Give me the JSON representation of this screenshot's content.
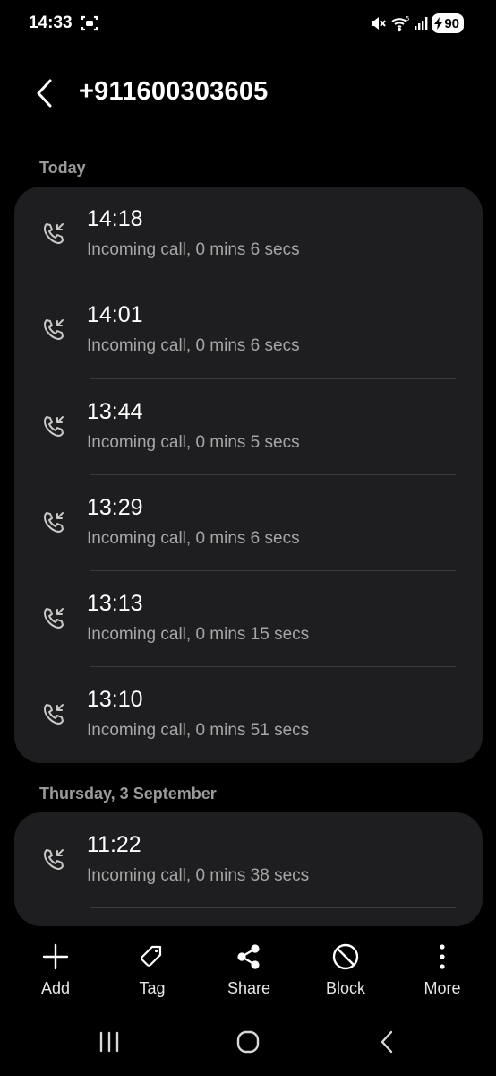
{
  "status_bar": {
    "time": "14:33",
    "battery_level": "90",
    "icons": [
      "screenshot-icon",
      "mute-icon",
      "wifi-icon",
      "signal-icon",
      "battery-charging-icon"
    ]
  },
  "header": {
    "title": "+911600303605",
    "back_icon": "chevron-left-icon"
  },
  "sections": [
    {
      "label": "Today",
      "calls": [
        {
          "time": "14:18",
          "description": "Incoming call, 0 mins 6 secs"
        },
        {
          "time": "14:01",
          "description": "Incoming call, 0 mins 6 secs"
        },
        {
          "time": "13:44",
          "description": "Incoming call, 0 mins 5 secs"
        },
        {
          "time": "13:29",
          "description": "Incoming call, 0 mins 6 secs"
        },
        {
          "time": "13:13",
          "description": "Incoming call, 0 mins 15 secs"
        },
        {
          "time": "13:10",
          "description": "Incoming call, 0 mins 51 secs"
        }
      ]
    },
    {
      "label": "Thursday, 3 September",
      "calls": [
        {
          "time": "11:22",
          "description": "Incoming call, 0 mins 38 secs"
        }
      ]
    }
  ],
  "actions": [
    {
      "label": "Add",
      "icon": "plus-icon"
    },
    {
      "label": "Tag",
      "icon": "tag-icon"
    },
    {
      "label": "Share",
      "icon": "share-icon"
    },
    {
      "label": "Block",
      "icon": "block-icon"
    },
    {
      "label": "More",
      "icon": "more-vertical-icon"
    }
  ],
  "navbar": {
    "icons": [
      "recent-apps-icon",
      "home-icon",
      "back-icon"
    ]
  },
  "colors": {
    "background": "#000000",
    "card": "#1e1e20",
    "primary_text": "#ffffff",
    "secondary_text": "#a6a6a6",
    "section_label": "#9a9a9a"
  }
}
